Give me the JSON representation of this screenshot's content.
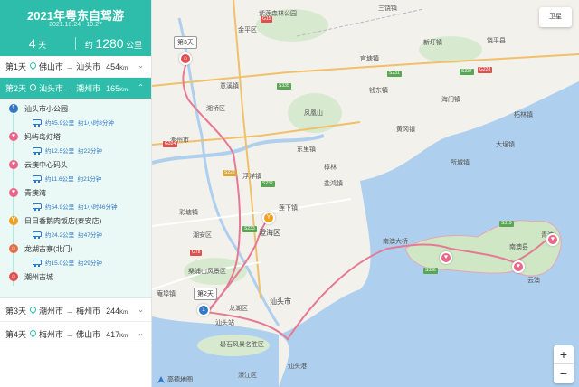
{
  "header": {
    "title": "2021年粤东自驾游",
    "dates": "2021.10.24 - 10.27",
    "days_num": "4",
    "days_unit": "天",
    "dist_prefix": "约",
    "dist_num": "1280",
    "dist_unit": "公里"
  },
  "days": [
    {
      "label": "第1天",
      "from": "佛山市",
      "arrow": "→",
      "to": "汕头市",
      "km": "454",
      "unit": "Km",
      "active": false
    },
    {
      "label": "第2天",
      "from": "汕头市",
      "arrow": "→",
      "to": "潮州市",
      "km": "165",
      "unit": "Km",
      "active": true
    },
    {
      "label": "第3天",
      "from": "潮州市",
      "arrow": "→",
      "to": "梅州市",
      "km": "244",
      "unit": "Km",
      "active": false
    },
    {
      "label": "第4天",
      "from": "梅州市",
      "arrow": "→",
      "to": "佛山市",
      "km": "417",
      "unit": "Km",
      "active": false
    }
  ],
  "stops": [
    {
      "name": "汕头市小公园",
      "icon": "1",
      "color": "#2f79c7"
    },
    {
      "name": "妈屿岛灯塔",
      "icon": "♥",
      "color": "#e9668a"
    },
    {
      "name": "云澳中心码头",
      "icon": "♥",
      "color": "#e9668a"
    },
    {
      "name": "青澳湾",
      "icon": "♥",
      "color": "#e9668a"
    },
    {
      "name": "日日香鹅肉饭店(泰安店)",
      "icon": "Y",
      "color": "#f0a020"
    },
    {
      "name": "龙湖古寨(北门)",
      "icon": "⌂",
      "color": "#e0704a"
    },
    {
      "name": "潮州古城",
      "icon": "⌂",
      "color": "#e05050"
    }
  ],
  "legs": [
    {
      "dist": "约45.9公里",
      "time": "约1小时8分钟"
    },
    {
      "dist": "约12.5公里",
      "time": "约22分钟"
    },
    {
      "dist": "约11.6公里",
      "time": "约21分钟"
    },
    {
      "dist": "约54.9公里",
      "time": "约1小时46分钟"
    },
    {
      "dist": "约24.2公里",
      "time": "约47分钟"
    },
    {
      "dist": "约15.0公里",
      "time": "约29分钟"
    }
  ],
  "map": {
    "labels": {
      "l1": "紫莲森林公园",
      "l2": "凤凰山",
      "l3": "饶平县",
      "l4": "柘林镇",
      "l5": "南澳县",
      "l6": "汕头市",
      "l7": "澄海区",
      "l8": "潮安区",
      "l9": "潮州市",
      "l10": "南澳大桥",
      "l11": "汕头港",
      "l12": "礐石风景名胜区",
      "l13": "海门镇",
      "l14": "湘桥区",
      "l15": "意溪镇",
      "l16": "黄冈镇",
      "l17": "东里镇",
      "l18": "莲下镇",
      "l19": "龙湖区",
      "l20": "金平区",
      "l21": "濠江区",
      "l22": "桑浦山风景区",
      "l23": "钱东镇",
      "l24": "樟林",
      "l25": "官塘镇",
      "l26": "庵埠镇",
      "l27": "彩塘镇",
      "l28": "汕头站",
      "l29": "大埕镇",
      "l30": "所城镇",
      "l31": "三饶镇",
      "l32": "新圩镇",
      "l33": "浮洋镇",
      "l34": "盐鸿镇",
      "l35": "青澳",
      "l36": "云澳"
    },
    "tags": {
      "day3": "第3天",
      "day2": "第2天"
    },
    "roads": {
      "r1": "G15",
      "r2": "S335",
      "r3": "S222",
      "r4": "S232",
      "r5": "G324",
      "r6": "G78",
      "r7": "S231",
      "r8": "S337",
      "r9": "S319",
      "r10": "G228",
      "r11": "S233",
      "r12": "S336"
    },
    "satellite": "卫星",
    "zoom_in": "+",
    "zoom_out": "−",
    "logo": "高德地图"
  }
}
